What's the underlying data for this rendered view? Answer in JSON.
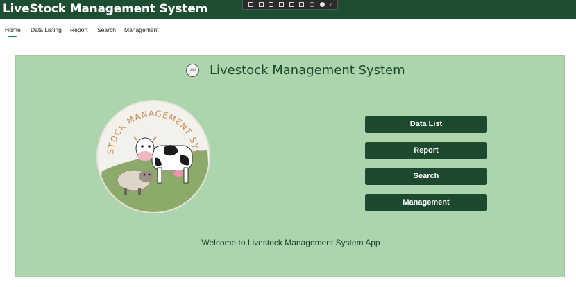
{
  "app": {
    "title": "LiveStock Management System"
  },
  "nav": {
    "items": [
      {
        "label": "Home"
      },
      {
        "label": "Data Listing"
      },
      {
        "label": "Report"
      },
      {
        "label": "Search"
      },
      {
        "label": "Management"
      }
    ],
    "active": "Home"
  },
  "main": {
    "logo_text": "LMS",
    "title": "Livestock Management System",
    "illustration_text": "LIVESTOCK MANAGEMENT SYSTEM",
    "buttons": {
      "data_list": "Data List",
      "report": "Report",
      "search": "Search",
      "management": "Management"
    },
    "welcome": "Welcome to Livestock Management System App"
  },
  "colors": {
    "header_bg": "#1e4e31",
    "panel_bg": "#acd5ae",
    "button_bg": "#1d4a2e",
    "nav_underline": "#1f6fb2"
  }
}
